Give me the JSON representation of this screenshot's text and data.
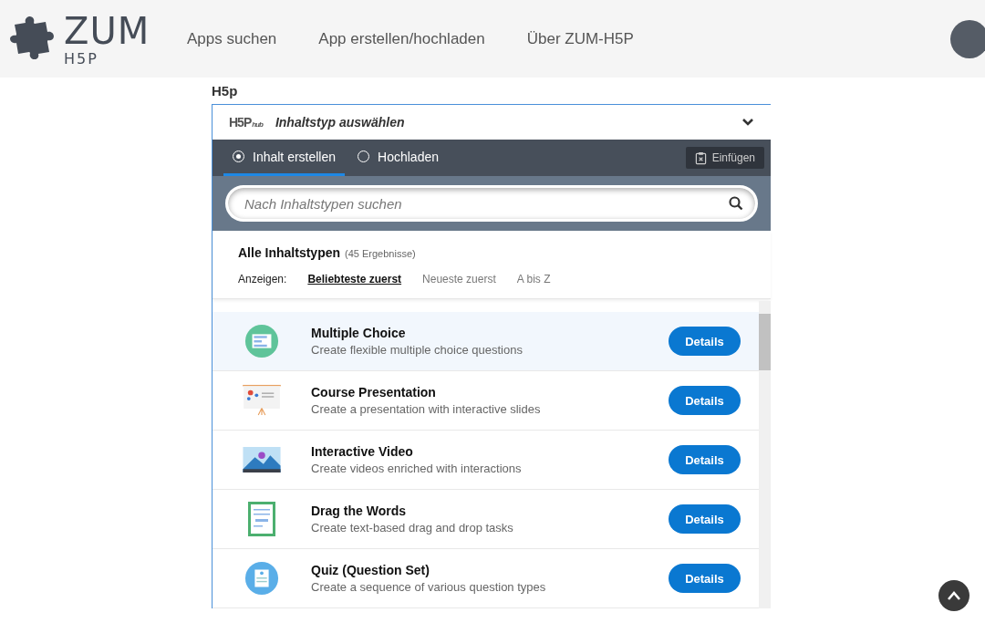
{
  "header": {
    "logo_text": "ZUM",
    "logo_subtext": "H5P",
    "nav": [
      {
        "label": "Apps suchen"
      },
      {
        "label": "App erstellen/hochladen"
      },
      {
        "label": "Über ZUM-H5P"
      }
    ]
  },
  "section_label": "H5p",
  "hub": {
    "logo_text": "H5P",
    "logo_suffix": "hub",
    "title": "Inhaltstyp auswählen",
    "expanded": true,
    "tabs": [
      {
        "label": "Inhalt erstellen",
        "selected": true
      },
      {
        "label": "Hochladen",
        "selected": false
      }
    ],
    "paste_button": "Einfügen",
    "search": {
      "placeholder": "Nach Inhaltstypen suchen"
    },
    "results_title": "Alle Inhaltstypen",
    "results_count": "(45 Ergebnisse)",
    "sort_label": "Anzeigen:",
    "sort_options": [
      {
        "label": "Beliebteste zuerst",
        "selected": true
      },
      {
        "label": "Neueste zuerst",
        "selected": false
      },
      {
        "label": "A bis Z",
        "selected": false
      }
    ],
    "items": [
      {
        "kind": "multiple-choice",
        "title": "Multiple Choice",
        "description": "Create flexible multiple choice questions",
        "button": "Details",
        "selected": true
      },
      {
        "kind": "presentation",
        "title": "Course Presentation",
        "description": "Create a presentation with interactive slides",
        "button": "Details",
        "selected": false
      },
      {
        "kind": "video",
        "title": "Interactive Video",
        "description": "Create videos enriched with interactions",
        "button": "Details",
        "selected": false
      },
      {
        "kind": "document",
        "title": "Drag the Words",
        "description": "Create text-based drag and drop tasks",
        "button": "Details",
        "selected": false
      },
      {
        "kind": "quiz",
        "title": "Quiz (Question Set)",
        "description": "Create a sequence of various question types",
        "button": "Details",
        "selected": false
      }
    ]
  }
}
